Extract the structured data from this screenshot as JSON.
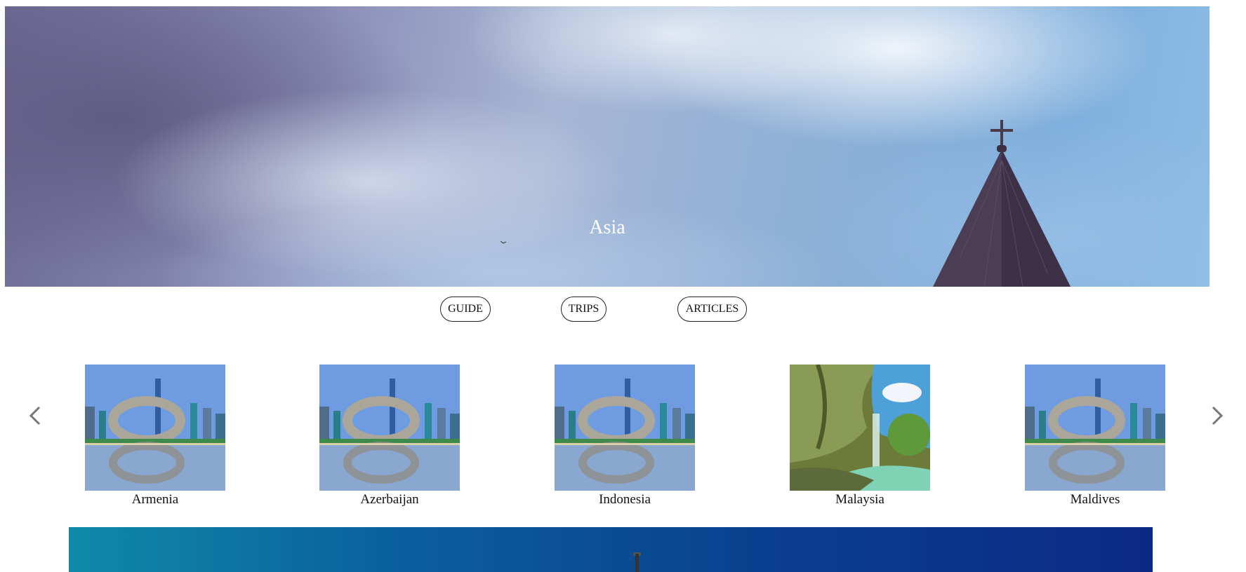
{
  "hero": {
    "title": "Asia",
    "image_icon": "church-spire-sky-image"
  },
  "nav": {
    "guide_label": "GUIDE",
    "trips_label": "TRIPS",
    "articles_label": "ARTICLES"
  },
  "carousel": {
    "prev_icon": "chevron-left-icon",
    "next_icon": "chevron-right-icon",
    "items": [
      {
        "label": "Armenia",
        "image": "museum-of-future-image"
      },
      {
        "label": "Azerbaijan",
        "image": "museum-of-future-image"
      },
      {
        "label": "Indonesia",
        "image": "museum-of-future-image"
      },
      {
        "label": "Malaysia",
        "image": "waterfall-grotto-image"
      },
      {
        "label": "Maldives",
        "image": "museum-of-future-image"
      }
    ]
  },
  "colors": {
    "text": "#111111",
    "button_border": "#222222",
    "arrow": "#777777",
    "banner_start": "#0f8aa8",
    "banner_end": "#0b2a84"
  }
}
